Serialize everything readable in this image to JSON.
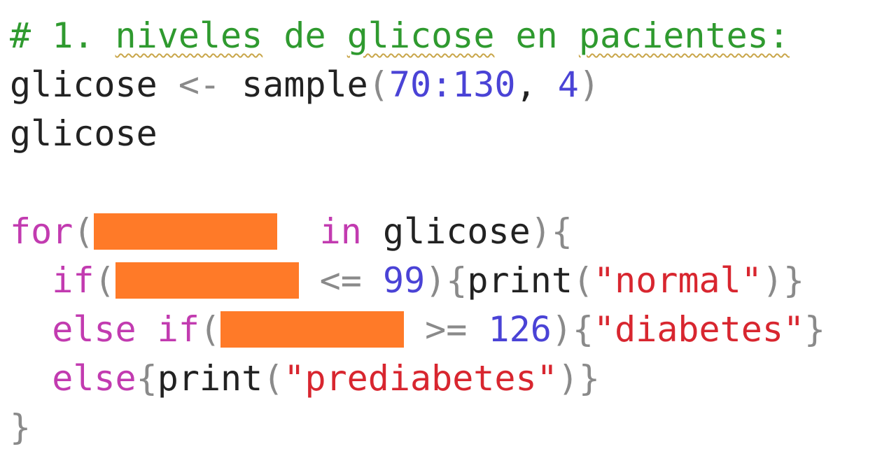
{
  "editor": {
    "line1": {
      "comment_hash": "#",
      "comment_num": "1.",
      "comment_w1": "niveles",
      "comment_w2": "de",
      "comment_w3": "glicose",
      "comment_w4": "en",
      "comment_w5": "pacientes:"
    },
    "line2": {
      "var": "glicose",
      "assign": "<-",
      "func": "sample",
      "open": "(",
      "range": "70:130",
      "comma": ", ",
      "size": "4",
      "close": ")"
    },
    "line3": {
      "var": "glicose"
    },
    "line5": {
      "kw_for": "for",
      "open": "(",
      "kw_in": "in",
      "iter": "glicose",
      "close": "){"
    },
    "line6": {
      "kw_if": "if",
      "open": "(",
      "op": "<=",
      "num": "99",
      "close": "){",
      "func": "print",
      "popen": "(",
      "str": "\"normal\"",
      "pclose": ")}"
    },
    "line7": {
      "kw_else_if": "else if",
      "open": "(",
      "op": ">=",
      "num": "126",
      "close": "){",
      "str": "\"diabetes\"",
      "brace": "}"
    },
    "line8": {
      "kw_else": "else",
      "brace_open": "{",
      "func": "print",
      "popen": "(",
      "str": "\"prediabetes\"",
      "pclose": ")}"
    },
    "line9": {
      "brace": "}"
    }
  },
  "colors": {
    "comment": "#2f9a2f",
    "keyword": "#c23bb0",
    "number": "#4a43d6",
    "string": "#d8262f",
    "operator": "#8a8a8a",
    "identifier": "#222222",
    "redaction": "#ff7a28"
  }
}
